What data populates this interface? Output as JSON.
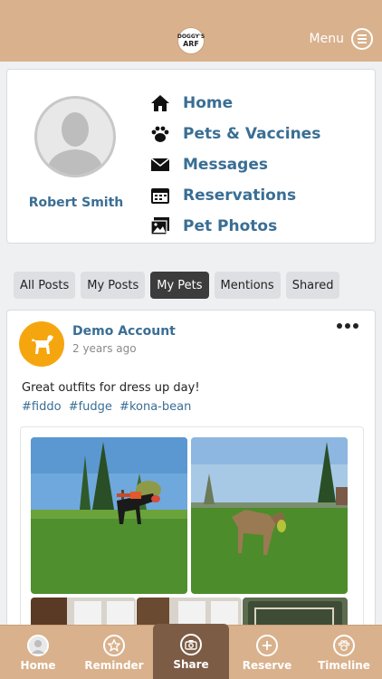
{
  "header": {
    "logo_text_top": "DOGGY'S",
    "logo_text_bottom": "ARF",
    "menu_label": "Menu"
  },
  "profile": {
    "name": "Robert Smith"
  },
  "nav": {
    "items": [
      {
        "label": "Home",
        "icon": "house-icon"
      },
      {
        "label": "Pets & Vaccines",
        "icon": "paw-icon"
      },
      {
        "label": "Messages",
        "icon": "envelope-icon"
      },
      {
        "label": "Reservations",
        "icon": "calendar-icon"
      },
      {
        "label": "Pet Photos",
        "icon": "photos-icon"
      }
    ]
  },
  "tabs": [
    {
      "label": "All Posts",
      "active": false
    },
    {
      "label": "My Posts",
      "active": false
    },
    {
      "label": "My Pets",
      "active": true
    },
    {
      "label": "Mentions",
      "active": false
    },
    {
      "label": "Shared",
      "active": false
    }
  ],
  "post": {
    "author": "Demo Account",
    "time": "2 years ago",
    "text": "Great outfits for dress up day!",
    "tags": [
      "#fiddo",
      "#fudge",
      "#kona-bean"
    ]
  },
  "bottom_nav": [
    {
      "label": "Home",
      "icon": "avatar-icon"
    },
    {
      "label": "Reminder",
      "icon": "star-icon"
    },
    {
      "label": "Share",
      "icon": "camera-icon"
    },
    {
      "label": "Reserve",
      "icon": "plus-icon"
    },
    {
      "label": "Timeline",
      "icon": "paw-icon"
    }
  ],
  "colors": {
    "brand_tan": "#d9b18c",
    "link_blue": "#3a6e94",
    "share_brown": "#7d5c46",
    "avatar_orange": "#f5a60f"
  }
}
